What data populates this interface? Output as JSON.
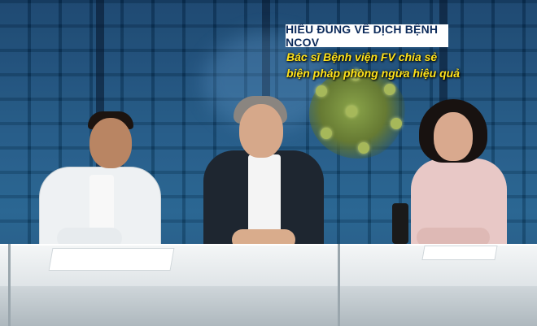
{
  "caption": {
    "title": "HIỂU ĐÚNG VỀ DỊCH BỆNH NCOV",
    "line1": "Bác sĩ Bệnh viện FV chia sẻ",
    "line2": "biện pháp phòng ngừa hiệu quả"
  },
  "colors": {
    "title_bg": "#ffffff",
    "title_text": "#0b2a5a",
    "subtitle_text": "#ffe21a",
    "backdrop": "#16507f"
  }
}
